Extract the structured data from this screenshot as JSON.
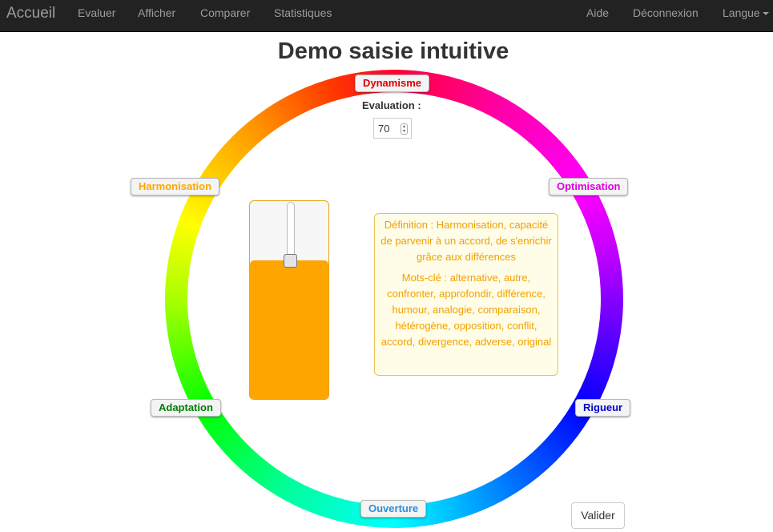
{
  "navbar": {
    "brand": "Accueil",
    "links": [
      "Evaluer",
      "Afficher",
      "Comparer",
      "Statistiques"
    ],
    "right_links": [
      "Aide",
      "Déconnexion",
      "Langue"
    ]
  },
  "page": {
    "title": "Demo saisie intuitive"
  },
  "wheel": {
    "labels": [
      {
        "text": "Dynamisme",
        "color": "#dd0000"
      },
      {
        "text": "Optimisation",
        "color": "#dd00dd"
      },
      {
        "text": "Rigueur",
        "color": "#0000cc"
      },
      {
        "text": "Ouverture",
        "color": "#2a8fd8"
      },
      {
        "text": "Adaptation",
        "color": "#008000"
      },
      {
        "text": "Harmonisation",
        "color": "#ffa500"
      }
    ]
  },
  "evaluation": {
    "label": "Evaluation :",
    "value": "70",
    "level_fraction": 0.7
  },
  "definition": {
    "definition_text": "Définition : Harmonisation, capacité de parvenir à un accord, de s'enrichir grâce aux différences",
    "keywords_text": "Mots-clé : alternative, autre, confronter, approfondir, différence, humour, analogie, comparaison, hétérogène, opposition, conflit, accord, divergence, adverse, original"
  },
  "actions": {
    "validate_label": "Valider"
  }
}
